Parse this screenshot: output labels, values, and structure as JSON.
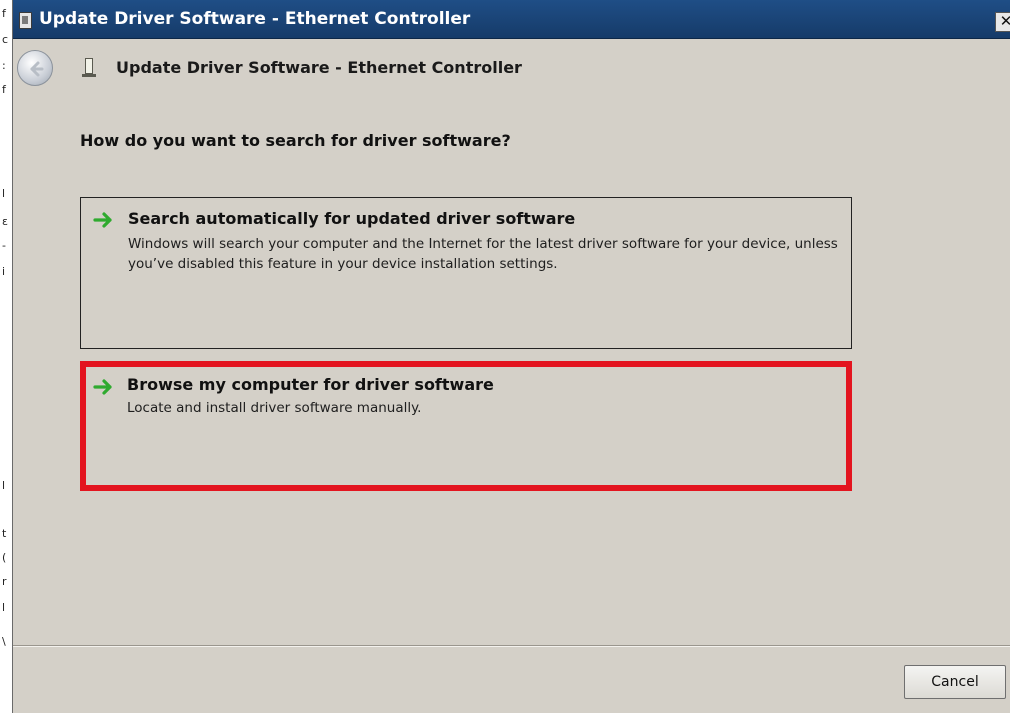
{
  "background_window": {
    "edge_chars": [
      "f",
      "c",
      ":",
      "f",
      "l",
      "ɛ",
      "-",
      "i",
      "l",
      "t",
      "(",
      "r",
      "l",
      "\\"
    ]
  },
  "window": {
    "title": "Update Driver Software - Ethernet Controller",
    "close_glyph": "✕"
  },
  "header": {
    "title": "Update Driver Software - Ethernet Controller",
    "back_icon": "back-arrow-icon",
    "app_icon": "network-card-icon"
  },
  "main": {
    "question": "How do you want to search for driver software?",
    "options": [
      {
        "title": "Search automatically for updated driver software",
        "description": "Windows will search your computer and the Internet for the latest driver software for your device, unless you’ve disabled this feature in your device installation settings.",
        "icon": "green-arrow-icon"
      },
      {
        "title": "Browse my computer for driver software",
        "description": "Locate and install driver software manually.",
        "icon": "green-arrow-icon",
        "highlighted": true,
        "highlight_color": "#e3141f"
      }
    ]
  },
  "footer": {
    "cancel_label": "Cancel"
  },
  "colors": {
    "titlebar": "#1f4e86",
    "dialog_bg": "#d4d0c8",
    "arrow_green": "#2faa2f",
    "highlight": "#e3141f"
  }
}
